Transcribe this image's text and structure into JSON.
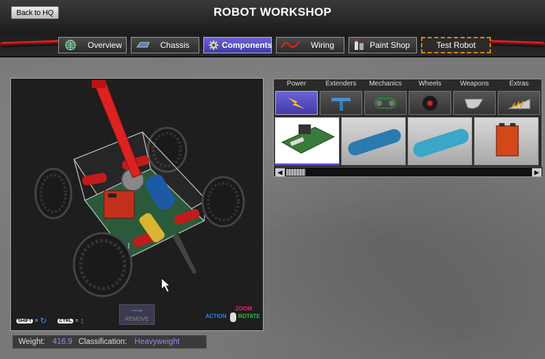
{
  "header": {
    "title": "ROBOT WORKSHOP",
    "back_label": "Back to HQ"
  },
  "tabs": [
    {
      "label": "Overview",
      "icon": "globe-icon",
      "active": false
    },
    {
      "label": "Chassis",
      "icon": "chassis-icon",
      "active": false
    },
    {
      "label": "Components",
      "icon": "gear-icon",
      "active": true
    },
    {
      "label": "Wiring",
      "icon": "wire-icon",
      "active": false
    },
    {
      "label": "Paint Shop",
      "icon": "paint-icon",
      "active": false
    },
    {
      "label": "Test Robot",
      "icon": "",
      "active": false
    }
  ],
  "categories": [
    {
      "label": "Power",
      "icon": "lightning-icon",
      "active": true
    },
    {
      "label": "Extenders",
      "icon": "extender-icon",
      "active": false
    },
    {
      "label": "Mechanics",
      "icon": "chain-icon",
      "active": false
    },
    {
      "label": "Wheels",
      "icon": "wheel-icon",
      "active": false
    },
    {
      "label": "Weapons",
      "icon": "blade-icon",
      "active": false
    },
    {
      "label": "Extras",
      "icon": "wedge-icon",
      "active": false
    }
  ],
  "parts": [
    {
      "name": "circuit-board-part",
      "active": true
    },
    {
      "name": "blue-air-tank-part",
      "active": false
    },
    {
      "name": "co2-tank-part",
      "active": false
    },
    {
      "name": "battery-box-part",
      "active": false
    }
  ],
  "viewport": {
    "remove_label": "REMOVE",
    "shift_key": "SHIFT",
    "ctrl_key": "CTRL",
    "eq": "=",
    "action_label": "ACTION",
    "zoom_label": "ZOOM",
    "rotate_label": "ROTATE"
  },
  "status": {
    "weight_label": "Weight:",
    "weight_value": "416.9",
    "class_label": "Classification:",
    "class_value": "Heavyweight"
  },
  "colors": {
    "accent": "#5a52c8",
    "test_border": "#e08a00",
    "status_value": "#8f8cf0"
  }
}
